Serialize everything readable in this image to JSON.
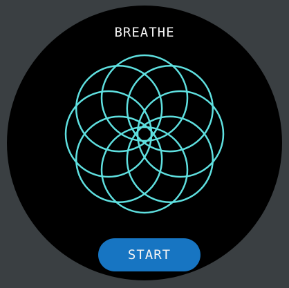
{
  "app": {
    "title": "BREATHE"
  },
  "controls": {
    "start_label": "START"
  },
  "breath_animation": {
    "icon": "breathing-flower-icon",
    "petal_count": 8,
    "colors": {
      "top": "#d08ae8",
      "bottom": "#5fe0e0"
    }
  },
  "colors": {
    "background": "#3a3f42",
    "face": "#000000",
    "button": "#1775c2",
    "text": "#f2f2f2"
  }
}
